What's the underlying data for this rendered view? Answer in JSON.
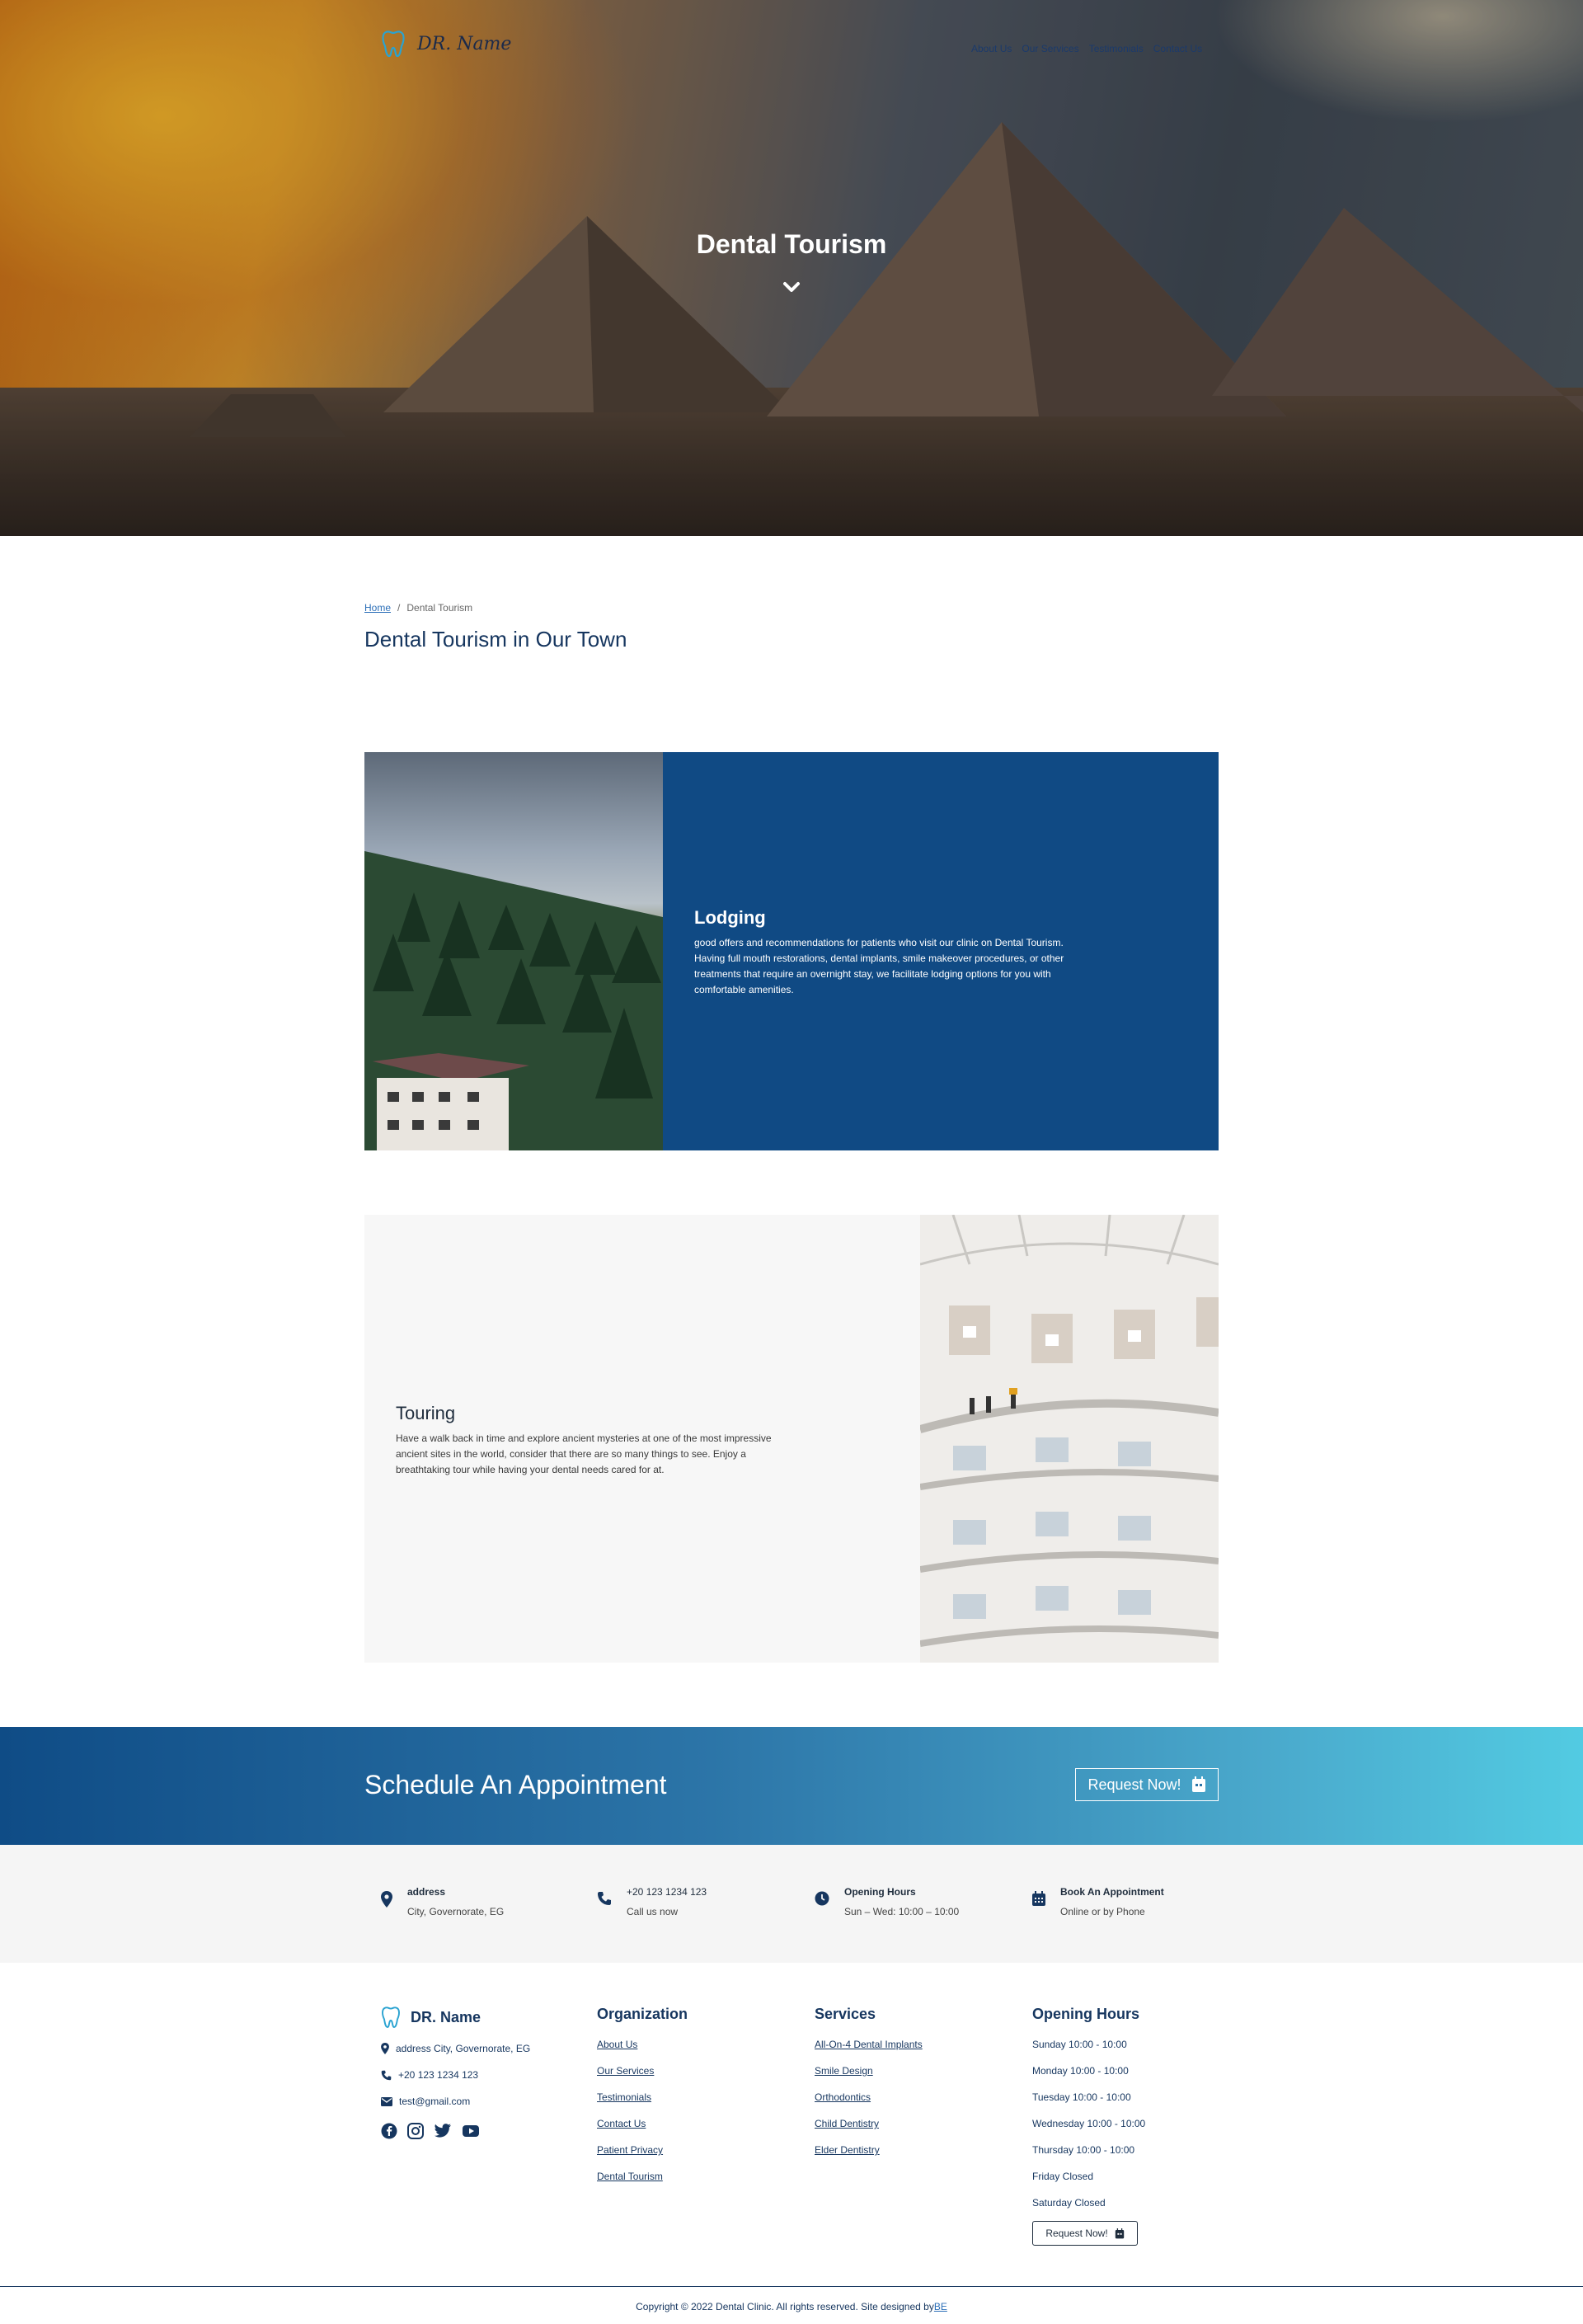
{
  "header": {
    "brand": "DR. Name",
    "nav": [
      "About Us",
      "Our Services",
      "Testimonials",
      "Contact Us"
    ]
  },
  "hero": {
    "title": "Dental Tourism"
  },
  "breadcrumb": {
    "home": "Home",
    "separator": "/",
    "current": "Dental Tourism"
  },
  "page_title": "Dental Tourism in Our Town",
  "lodging": {
    "title": "Lodging",
    "text": "good offers and recommendations for patients who visit our clinic on Dental Tourism. Having full mouth restorations, dental implants, smile makeover procedures, or other treatments that require an overnight stay, we facilitate lodging options for you with comfortable amenities."
  },
  "touring": {
    "title": "Touring",
    "text": "Have a walk back in time and explore ancient mysteries at one of the most impressive ancient sites in the world, consider that there are so many things to see. Enjoy a breathtaking tour while having your dental needs cared for at."
  },
  "appointment": {
    "title": "Schedule An Appointment",
    "button": "Request Now!"
  },
  "info": [
    {
      "icon": "map-pin-icon",
      "title": "address",
      "sub": "City, Governorate, EG"
    },
    {
      "icon": "phone-icon",
      "title": "+20 123 1234 123",
      "sub": "Call us now"
    },
    {
      "icon": "clock-icon",
      "title": "Opening Hours",
      "sub": "Sun – Wed: 10:00 – 10:00"
    },
    {
      "icon": "calendar-icon",
      "title": "Book An Appointment",
      "sub": "Online or by Phone"
    }
  ],
  "footer": {
    "brand": "DR. Name",
    "address": "address City, Governorate, EG",
    "phone": "+20 123 1234 123",
    "email": "test@gmail.com",
    "organization": {
      "title": "Organization",
      "links": [
        "About Us",
        "Our Services",
        "Testimonials",
        "Contact Us",
        "Patient Privacy",
        "Dental Tourism"
      ]
    },
    "services": {
      "title": "Services",
      "links": [
        "All-On-4 Dental Implants",
        "Smile Design",
        "Orthodontics",
        "Child Dentistry",
        "Elder Dentistry"
      ]
    },
    "hours": {
      "title": "Opening Hours",
      "rows": [
        "Sunday 10:00 - 10:00",
        "Monday 10:00 - 10:00",
        "Tuesday 10:00 - 10:00",
        "Wednesday 10:00 - 10:00",
        "Thursday 10:00 - 10:00",
        "Friday Closed",
        "Saturday Closed"
      ],
      "button": "Request Now!"
    },
    "copyright": "Copyright © 2022 Dental Clinic. All rights reserved. Site designed by",
    "designer": "BE"
  },
  "colors": {
    "primary": "#104a84",
    "accent": "#52cbe2",
    "text": "#16365f"
  }
}
